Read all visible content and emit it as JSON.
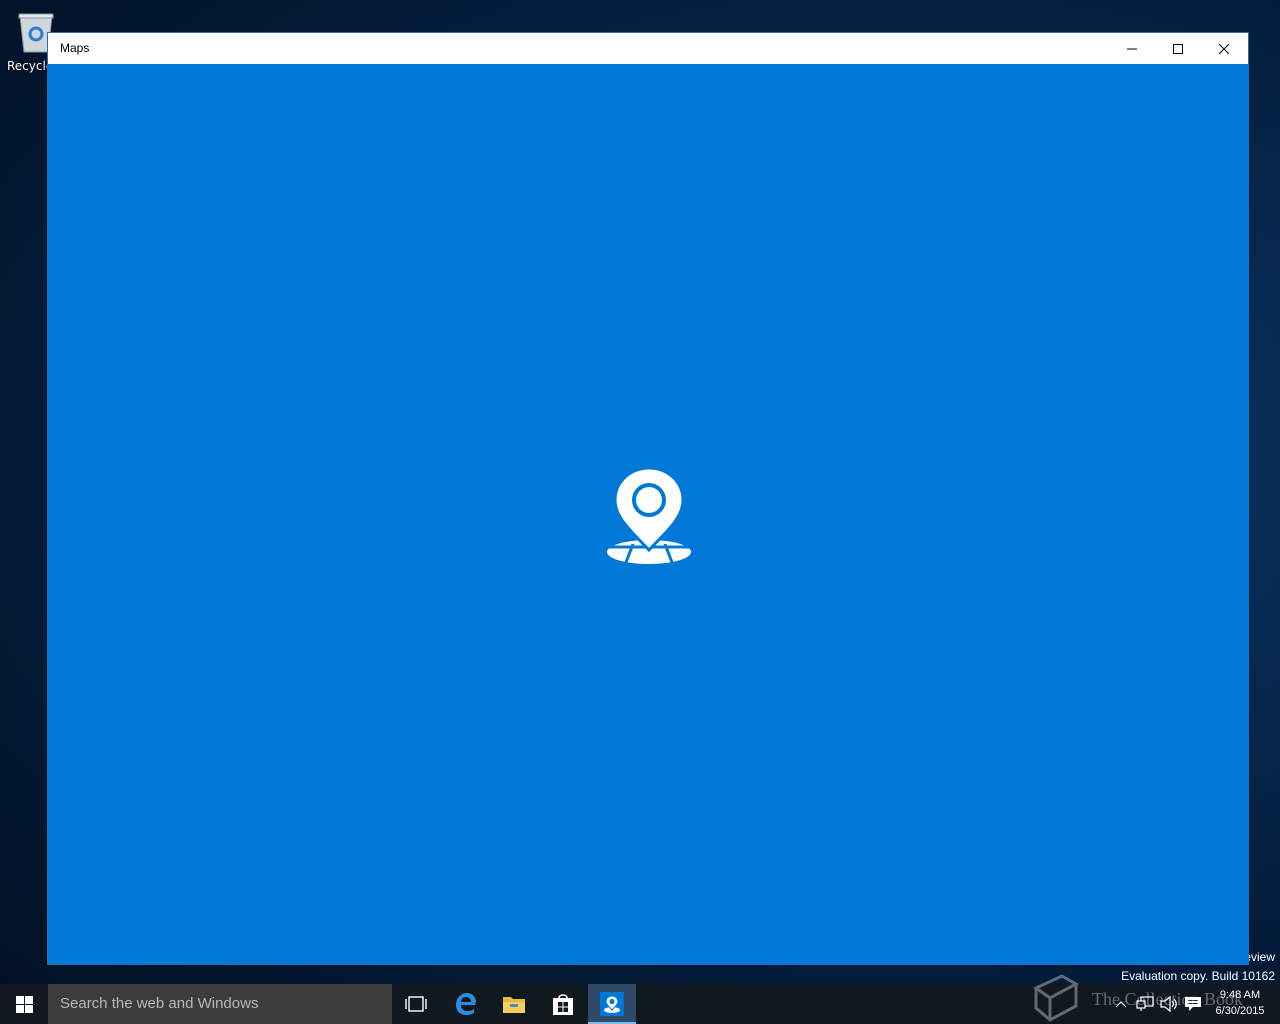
{
  "desktop": {
    "recycle_bin_label": "Recycle",
    "watermark_line1": "eview",
    "watermark_line2": "Evaluation copy. Build 10162",
    "overlay_text": "The Collection Book"
  },
  "window": {
    "title": "Maps",
    "minimize_icon": "minimize-icon",
    "maximize_icon": "maximize-icon",
    "close_icon": "close-icon",
    "background_color": "#0078d7",
    "splash_icon": "maps-pin-icon"
  },
  "taskbar": {
    "search_placeholder": "Search the web and Windows",
    "pinned": [
      "task-view",
      "edge",
      "file-explorer",
      "store",
      "maps"
    ],
    "active_app": "maps",
    "clock_time": "9:48 AM",
    "clock_date": "6/30/2015"
  }
}
